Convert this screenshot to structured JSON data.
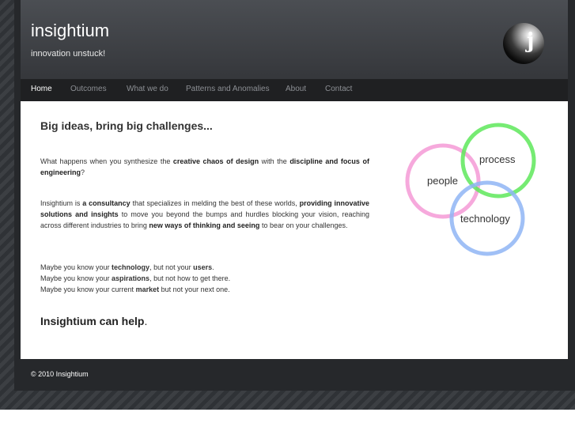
{
  "site": {
    "title": "insightium",
    "tagline": "innovation unstuck!",
    "logo_glyph": "j"
  },
  "nav": {
    "items": [
      {
        "label": "Home",
        "active": true
      },
      {
        "label": "Outcomes"
      },
      {
        "label": "What we do"
      },
      {
        "label": "Patterns and Anomalies"
      },
      {
        "label": "About"
      },
      {
        "label": "Contact"
      }
    ]
  },
  "main": {
    "heading": "Big ideas, bring big challenges...",
    "p1": {
      "t1": "What happens when you synthesize the ",
      "b1": "creative chaos of design",
      "t2": " with the ",
      "b2": "discipline and focus of engineering",
      "t3": "?"
    },
    "p2": {
      "t1": "Insightium is ",
      "b1": "a consultancy",
      "t2": " that specializes in melding the best of these worlds, ",
      "b2": "providing innovative solutions and insights",
      "t3": " to move you beyond the bumps and hurdles blocking your vision, reaching across different industries to bring ",
      "b3": "new ways of thinking and seeing",
      "t4": " to bear on your challenges."
    },
    "lines": [
      {
        "t1": "Maybe you know your ",
        "b1": "technology",
        "t2": ", but not your ",
        "b2": "users",
        "t3": "."
      },
      {
        "t1": "Maybe you know your ",
        "b1": "aspirations",
        "t2": ", but not how to get there.",
        "b2": "",
        "t3": ""
      },
      {
        "t1": "Maybe you know your current ",
        "b1": "market",
        "t2": " but not your next one.",
        "b2": "",
        "t3": ""
      }
    ],
    "cta": {
      "bold": "Insightium can help",
      "tail": "."
    },
    "venn": {
      "labels": {
        "people": "people",
        "process": "process",
        "technology": "technology"
      },
      "colors": {
        "people": "#f59ad6",
        "process": "#5ee85a",
        "technology": "#8fb5f5"
      }
    }
  },
  "footer": {
    "copyright": "© 2010 Insightium"
  }
}
